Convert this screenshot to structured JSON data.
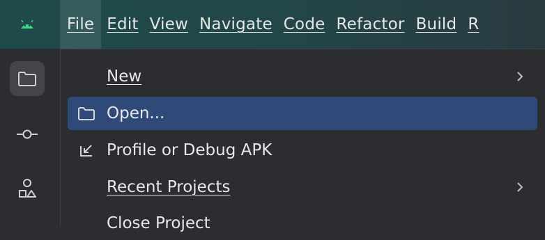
{
  "menubar": {
    "items": [
      {
        "label": "File",
        "active": true
      },
      {
        "label": "Edit"
      },
      {
        "label": "View"
      },
      {
        "label": "Navigate"
      },
      {
        "label": "Code"
      },
      {
        "label": "Refactor"
      },
      {
        "label": "Build"
      },
      {
        "label": "R"
      }
    ]
  },
  "sidebar": {
    "items": [
      {
        "icon": "folder-icon",
        "selected": true
      },
      {
        "icon": "commit-icon"
      },
      {
        "icon": "structure-icon"
      }
    ]
  },
  "file_menu": {
    "items": [
      {
        "label": "New",
        "icon": "",
        "submenu": true
      },
      {
        "label": "Open...",
        "icon": "folder-icon",
        "highlighted": true
      },
      {
        "label": "Profile or Debug APK",
        "icon": "import-arrow-icon"
      },
      {
        "label": "Recent Projects",
        "icon": "",
        "submenu": true
      },
      {
        "label": "Close Project",
        "icon": ""
      }
    ]
  },
  "colors": {
    "titlebar": "#1f4a4a",
    "menu_bg": "#2b2d30",
    "highlight": "#2f4a79",
    "text": "#e8e8e8"
  }
}
